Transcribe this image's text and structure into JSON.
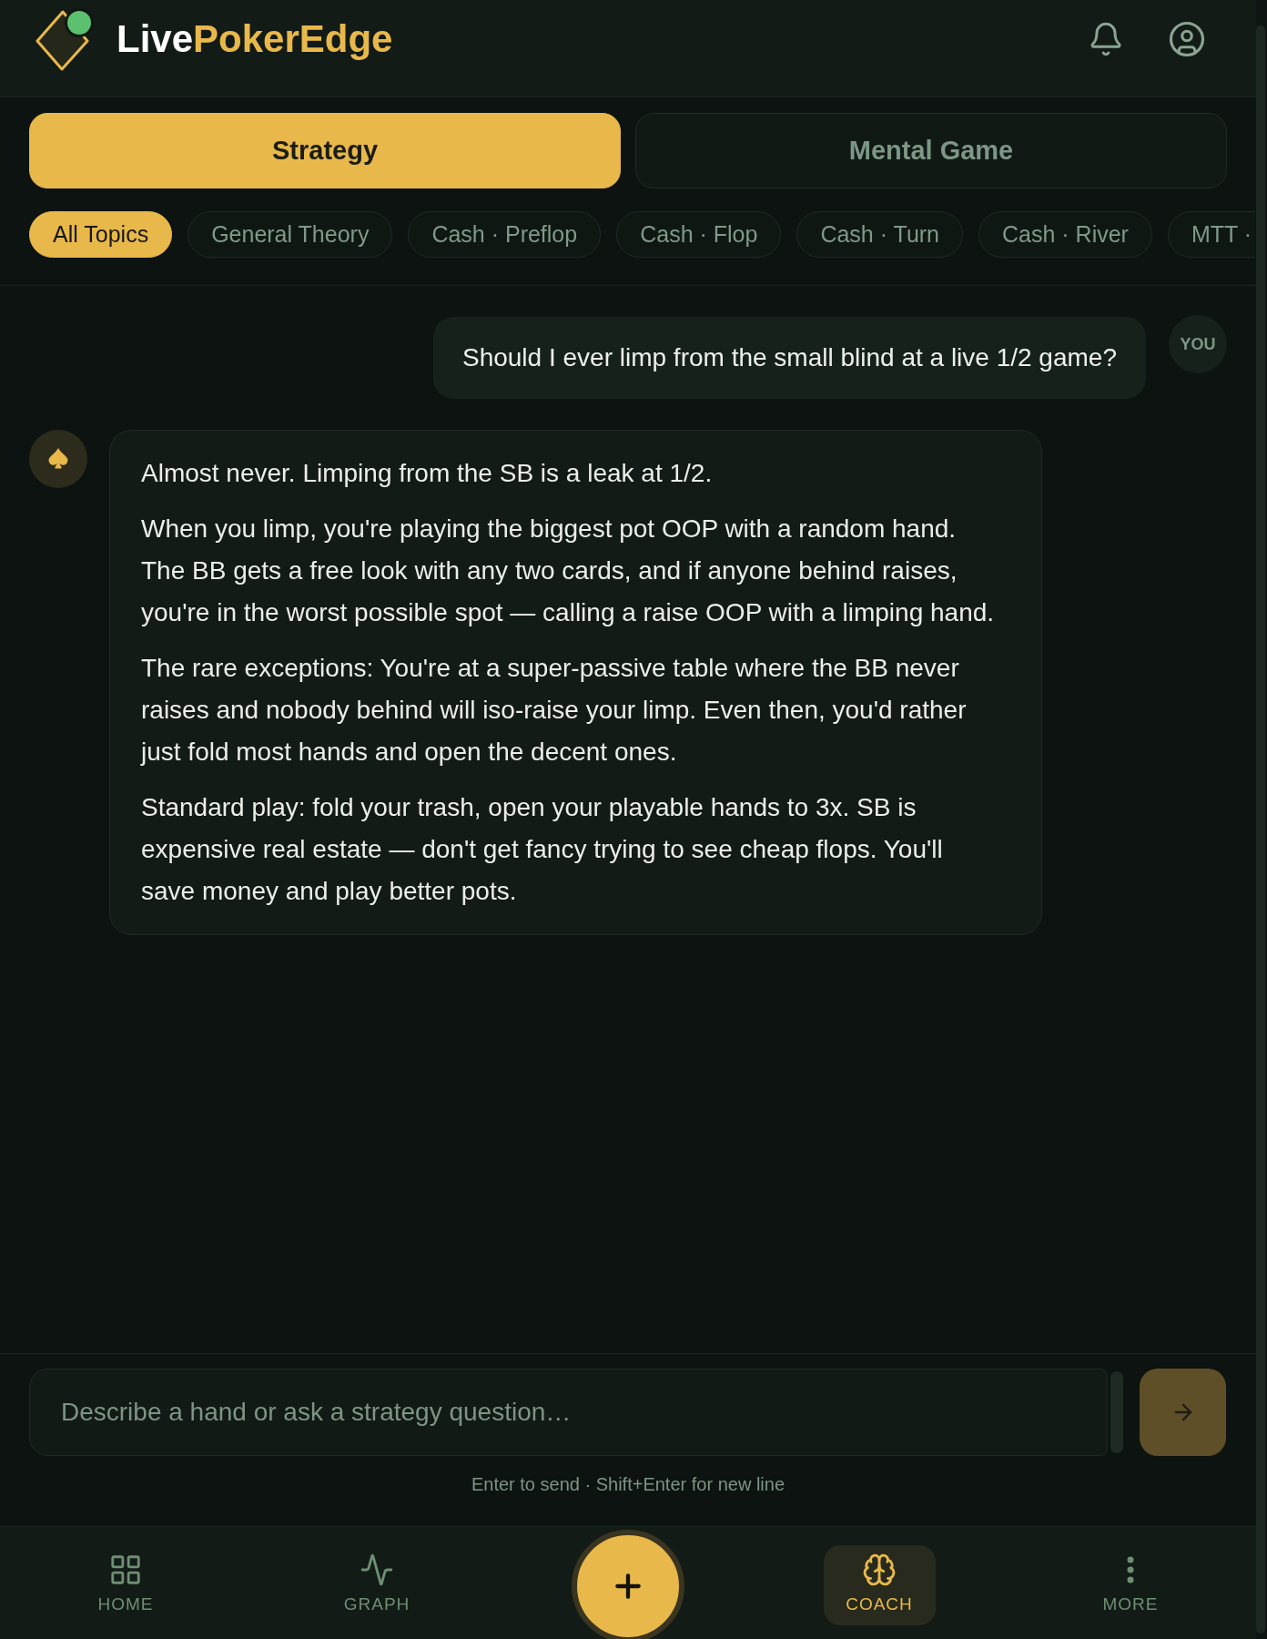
{
  "header": {
    "brand": [
      {
        "text": "Live",
        "kind": "plain"
      },
      {
        "text": "PokerEdge",
        "kind": "accent"
      }
    ]
  },
  "mode_tabs": [
    {
      "label": "Strategy",
      "selected": true
    },
    {
      "label": "Mental Game",
      "selected": false
    }
  ],
  "topic_chips": [
    {
      "label": "All Topics",
      "selected": true,
      "clipped": false
    },
    {
      "label": "General Theory",
      "selected": false,
      "clipped": false
    },
    {
      "label": "Cash · Preflop",
      "selected": false,
      "clipped": false
    },
    {
      "label": "Cash · Flop",
      "selected": false,
      "clipped": false
    },
    {
      "label": "Cash · Turn",
      "selected": false,
      "clipped": false
    },
    {
      "label": "Cash · River",
      "selected": false,
      "clipped": false
    },
    {
      "label": "MTT ·",
      "selected": false,
      "clipped": true
    }
  ],
  "messages": [
    {
      "kind": "user",
      "avatar": "YOU",
      "text": "Should I ever limp from the small blind at a live 1/2 game?"
    },
    {
      "kind": "coach",
      "paragraphs": [
        "Almost never. Limping from the SB is a leak at 1/2.",
        "When you limp, you're playing the biggest pot OOP with a random hand. The BB gets a free look with any two cards, and if anyone behind raises, you're in the worst possible spot — calling a raise OOP with a limping hand.",
        "The rare exceptions: You're at a super-passive table where the BB never raises and nobody behind will iso-raise your limp. Even then, you'd rather just fold most hands and open the decent ones.",
        "Standard play: fold your trash, open your playable hands to 3x. SB is expensive real estate — don't get fancy trying to see cheap flops. You'll save money and play better pots."
      ]
    }
  ],
  "composer": {
    "placeholder": "Describe a hand or ask a strategy question…",
    "send_disabled": true,
    "hint": "Enter to send · Shift+Enter for new line"
  },
  "bottom_nav": [
    {
      "kind": "tab",
      "label": "HOME",
      "selected": false
    },
    {
      "kind": "tab",
      "label": "GRAPH",
      "selected": false
    },
    {
      "kind": "add"
    },
    {
      "kind": "tab",
      "label": "COACH",
      "selected": true
    },
    {
      "kind": "tab",
      "label": "MORE",
      "selected": false
    }
  ]
}
